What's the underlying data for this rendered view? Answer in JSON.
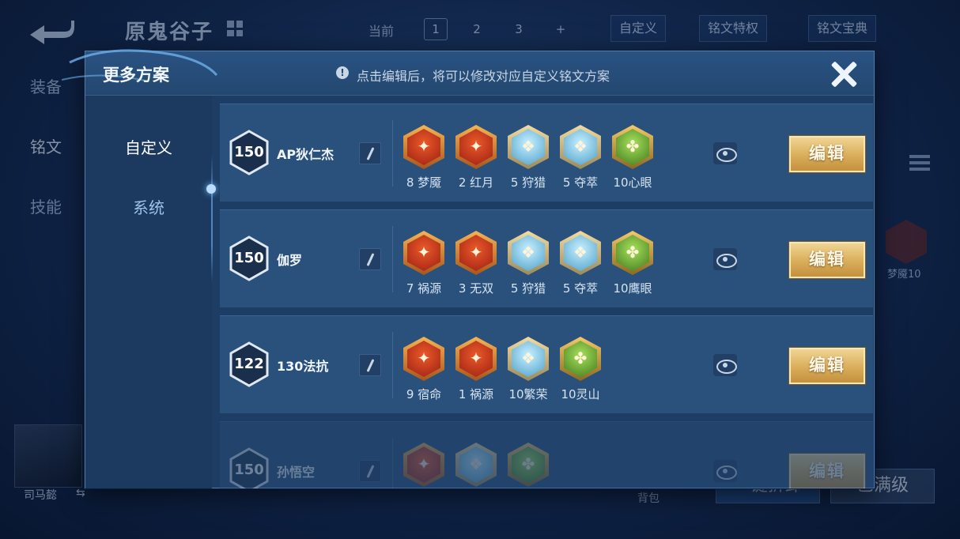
{
  "background": {
    "title": "原鬼谷子",
    "current_label": "当前",
    "pages": [
      "1",
      "2",
      "3",
      "+"
    ],
    "custom_btn": "自定义",
    "privilege_btn": "铭文特权",
    "codex_btn": "铭文宝典",
    "side_tabs": [
      "装备",
      "铭文",
      "技能"
    ],
    "hero_name": "司马懿",
    "bag_label": "背包",
    "rune_label": "梦魇10",
    "bottom_left_btn": "一键拆卸",
    "bottom_right_btn": "已满级"
  },
  "modal": {
    "title": "更多方案",
    "info_text": "点击编辑后，将可以修改对应自定义铭文方案",
    "tabs": [
      {
        "label": "自定义",
        "active": true
      },
      {
        "label": "系统",
        "active": false
      }
    ],
    "plans": [
      {
        "level": "150",
        "name": "AP狄仁杰",
        "runes": [
          {
            "label": "8 梦魇",
            "color": "red",
            "icon": "flame-crest-icon"
          },
          {
            "label": "2 红月",
            "color": "red",
            "icon": "crescent-moon-icon"
          },
          {
            "label": "5 狩猎",
            "color": "blue",
            "icon": "lightning-icon"
          },
          {
            "label": "5 夺萃",
            "color": "blue",
            "icon": "knot-icon"
          },
          {
            "label": "10心眼",
            "color": "green",
            "icon": "eye-gate-icon"
          }
        ],
        "edit_label": "编辑"
      },
      {
        "level": "150",
        "name": "伽罗",
        "runes": [
          {
            "label": "7 祸源",
            "color": "red",
            "icon": "claw-icon"
          },
          {
            "label": "3 无双",
            "color": "red",
            "icon": "diamond-icon"
          },
          {
            "label": "5 狩猎",
            "color": "blue",
            "icon": "lightning-icon"
          },
          {
            "label": "5 夺萃",
            "color": "blue",
            "icon": "knot-icon"
          },
          {
            "label": "10鹰眼",
            "color": "green",
            "icon": "clover-icon"
          }
        ],
        "edit_label": "编辑"
      },
      {
        "level": "122",
        "name": "130法抗",
        "runes": [
          {
            "label": "9 宿命",
            "color": "red",
            "icon": "flame-icon"
          },
          {
            "label": "1 祸源",
            "color": "red",
            "icon": "claw-icon"
          },
          {
            "label": "10繁荣",
            "color": "blue",
            "icon": "star-icon"
          },
          {
            "label": "10灵山",
            "color": "green",
            "icon": "mountain-icon"
          }
        ],
        "edit_label": "编辑"
      },
      {
        "level": "150",
        "name": "孙悟空",
        "runes": [
          {
            "label": "",
            "color": "red",
            "icon": "flame-crest-icon"
          },
          {
            "label": "",
            "color": "blue",
            "icon": "knot-icon"
          },
          {
            "label": "",
            "color": "green",
            "icon": "clover-icon"
          }
        ],
        "edit_label": "编辑"
      }
    ]
  },
  "colors": {
    "accent_gold": "#d9ad5a",
    "panel": "#1e3d64",
    "row": "#2a507c"
  }
}
